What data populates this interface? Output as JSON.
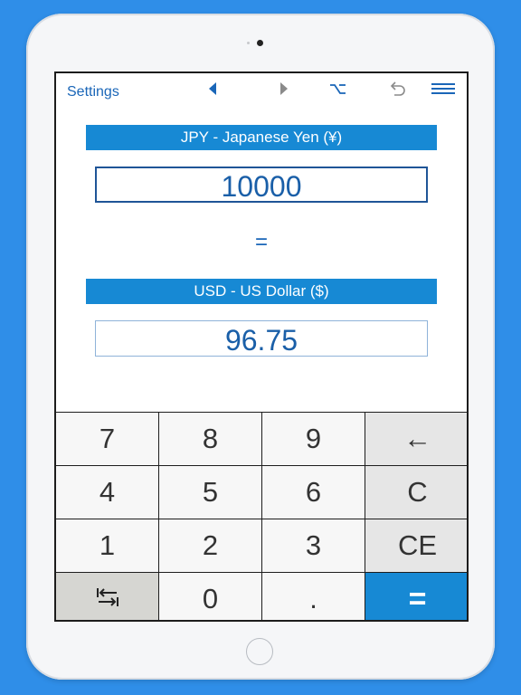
{
  "toolbar": {
    "settings_label": "Settings",
    "icons": [
      "previous-arrow-icon",
      "next-arrow-icon",
      "option-key-icon",
      "undo-icon",
      "menu-icon"
    ]
  },
  "source": {
    "currency_label": "JPY - Japanese Yen (¥)",
    "value": "10000"
  },
  "equals_label": "=",
  "target": {
    "currency_label": "USD - US Dollar ($)",
    "value": "96.75"
  },
  "keypad": {
    "key_7": "7",
    "key_8": "8",
    "key_9": "9",
    "key_backspace": "←",
    "key_4": "4",
    "key_5": "5",
    "key_6": "6",
    "key_clear": "C",
    "key_1": "1",
    "key_2": "2",
    "key_3": "3",
    "key_clear_entry": "CE",
    "key_swap_icon": "swap-icon",
    "key_0": "0",
    "key_decimal": ".",
    "key_equals": "="
  },
  "colors": {
    "background": "#2f8ee8",
    "accent": "#1789d4",
    "text_blue": "#1a66b8"
  }
}
